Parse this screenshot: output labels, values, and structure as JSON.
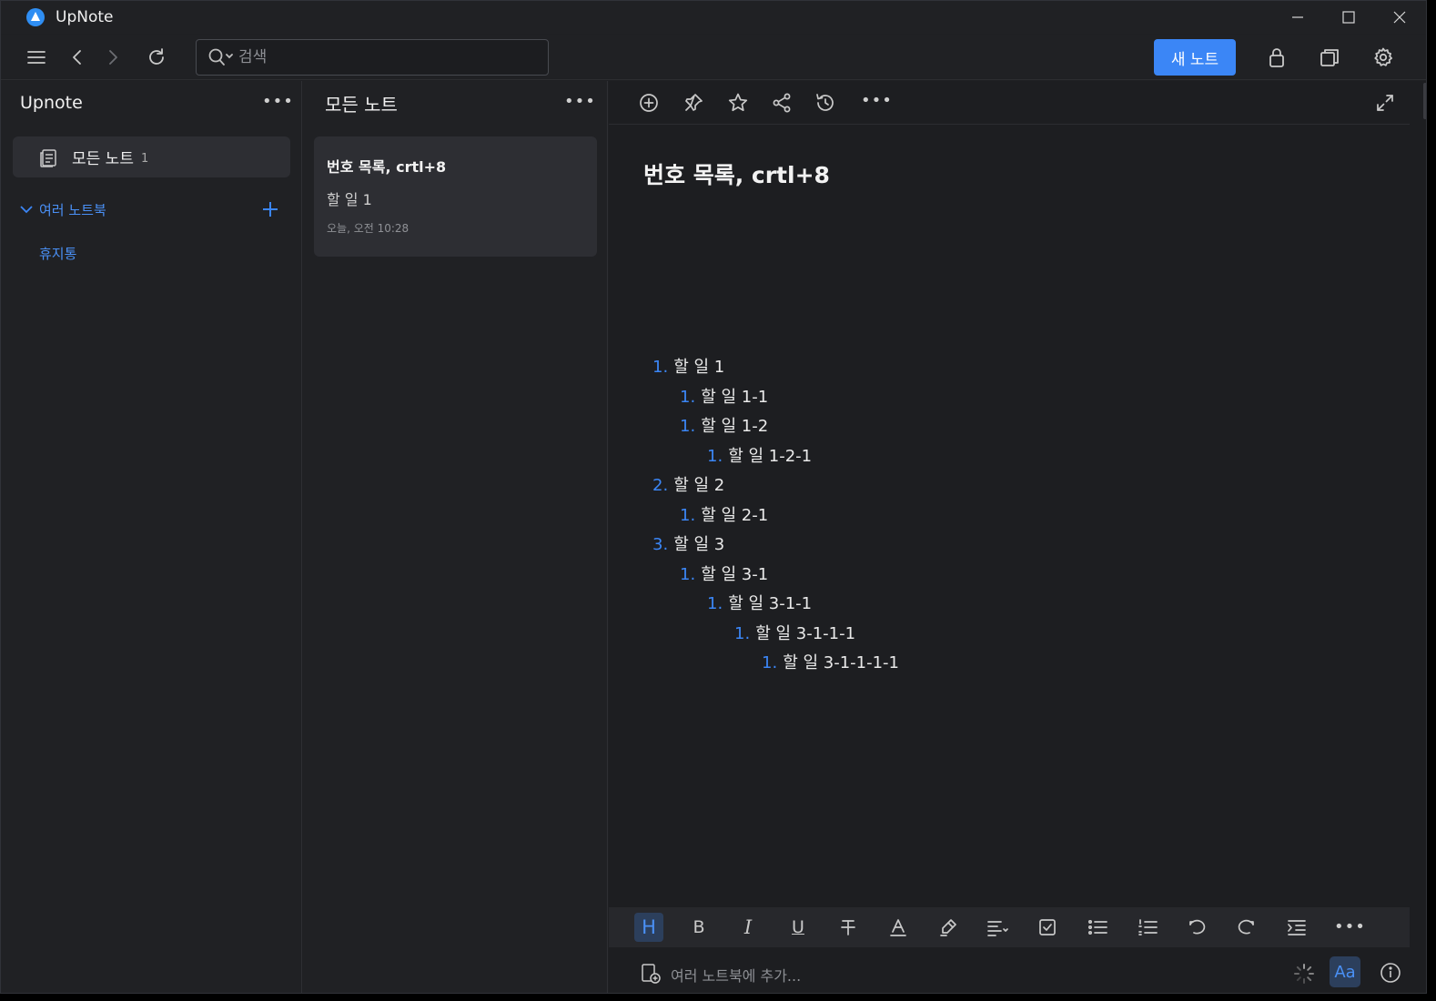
{
  "window": {
    "title": "UpNote"
  },
  "toolbar": {
    "search_placeholder": "검색",
    "new_note_label": "새 노트"
  },
  "sidebar": {
    "title": "Upnote",
    "all_notes_label": "모든 노트",
    "all_notes_count": "1",
    "notebooks_label": "여러 노트북",
    "trash_label": "휴지통"
  },
  "note_list": {
    "title": "모든 노트",
    "notes": [
      {
        "title": "번호 목록, crtl+8",
        "preview": "할 일 1",
        "date": "오늘, 오전 10:28"
      }
    ]
  },
  "editor": {
    "title": "번호 목록, crtl+8",
    "list": [
      {
        "num": "1.",
        "text": "할 일 1",
        "level": 0
      },
      {
        "num": "1.",
        "text": "할 일 1-1",
        "level": 1
      },
      {
        "num": "1.",
        "text": "할 일 1-2",
        "level": 1
      },
      {
        "num": "1.",
        "text": "할 일 1-2-1",
        "level": 2
      },
      {
        "num": "2.",
        "text": "할 일 2",
        "level": 0
      },
      {
        "num": "1.",
        "text": "할 일 2-1",
        "level": 1
      },
      {
        "num": "3.",
        "text": "할 일 3",
        "level": 0
      },
      {
        "num": "1.",
        "text": "할 일 3-1",
        "level": 1
      },
      {
        "num": "1.",
        "text": "할 일 3-1-1",
        "level": 2
      },
      {
        "num": "1.",
        "text": "할 일 3-1-1-1",
        "level": 3
      },
      {
        "num": "1.",
        "text": "할 일 3-1-1-1-1",
        "level": 4
      }
    ],
    "add_notebook_placeholder": "여러 노트북에 추가...",
    "font_button_label": "Aa",
    "format_bar": {
      "heading": "H",
      "bold": "B",
      "italic": "I",
      "underline": "U"
    }
  },
  "colors": {
    "accent": "#3b86f6",
    "background": "#1f2023",
    "panel": "#2d2e33"
  }
}
